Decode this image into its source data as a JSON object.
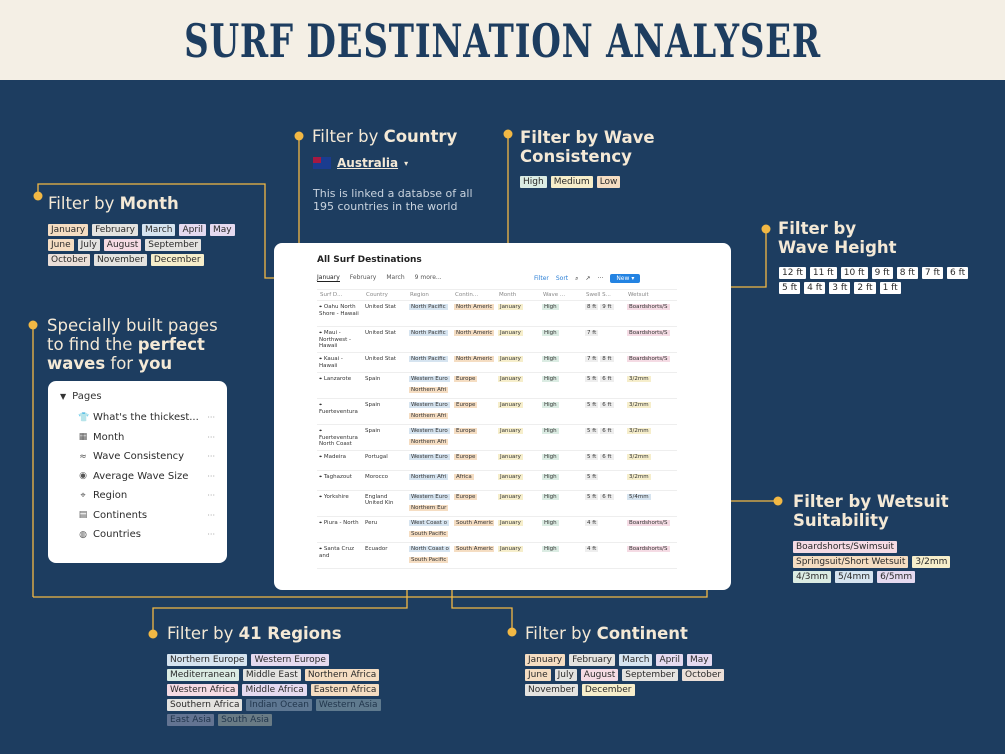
{
  "title": "SURF DESTINATION ANALYSER",
  "sections": {
    "country": {
      "heading_pre": "Filter by ",
      "heading_bold": "Country",
      "selected": "Australia",
      "note_line1": "This is linked a databse of all",
      "note_line2": "195 countries in the world"
    },
    "month": {
      "heading_pre": "Filter by ",
      "heading_bold": "Month",
      "chips": [
        {
          "label": "January",
          "color": "orange"
        },
        {
          "label": "February",
          "color": "gray"
        },
        {
          "label": "March",
          "color": "blue"
        },
        {
          "label": "April",
          "color": "purple"
        },
        {
          "label": "May",
          "color": "purple"
        },
        {
          "label": "June",
          "color": "orange"
        },
        {
          "label": "July",
          "color": "gray"
        },
        {
          "label": "August",
          "color": "pink"
        },
        {
          "label": "September",
          "color": "gray"
        },
        {
          "label": "October",
          "color": "brown"
        },
        {
          "label": "November",
          "color": "gray"
        },
        {
          "label": "December",
          "color": "yellow"
        }
      ]
    },
    "consistency": {
      "heading_line1": "Filter by Wave",
      "heading_line2": "Consistency",
      "chips": [
        {
          "label": "High",
          "color": "green"
        },
        {
          "label": "Medium",
          "color": "yellow"
        },
        {
          "label": "Low",
          "color": "orange"
        }
      ]
    },
    "wave_height": {
      "heading_line1": "Filter by",
      "heading_line2": "Wave Height",
      "chips": [
        "12 ft",
        "11 ft",
        "10 ft",
        "9 ft",
        "8 ft",
        "7 ft",
        "6 ft",
        "5 ft",
        "4 ft",
        "3 ft",
        "2 ft",
        "1 ft"
      ]
    },
    "pages_promo": {
      "line1": "Specially built pages",
      "line2_pre": "to find the ",
      "line2_bold": "perfect",
      "line3_bold1": "waves",
      "line3_mid": " for ",
      "line3_bold2": "you"
    },
    "wetsuit": {
      "heading_line1": "Filter by Wetsuit",
      "heading_line2": "Suitability",
      "chips": [
        {
          "label": "Boardshorts/Swimsuit",
          "color": "pink"
        },
        {
          "label": "Springsuit/Short Wetsuit",
          "color": "orange"
        },
        {
          "label": "3/2mm",
          "color": "yellow"
        },
        {
          "label": "4/3mm",
          "color": "green"
        },
        {
          "label": "5/4mm",
          "color": "blue"
        },
        {
          "label": "6/5mm",
          "color": "purple"
        }
      ]
    },
    "regions": {
      "heading_pre": "Filter by ",
      "heading_bold": "41 Regions",
      "chips": [
        {
          "label": "Northern Europe",
          "color": "blue"
        },
        {
          "label": "Western Europe",
          "color": "purple"
        },
        {
          "label": "Mediterranean",
          "color": "green"
        },
        {
          "label": "Middle East",
          "color": "gray"
        },
        {
          "label": "Northern Africa",
          "color": "orange"
        },
        {
          "label": "Western Africa",
          "color": "pink"
        },
        {
          "label": "Middle Africa",
          "color": "purple"
        },
        {
          "label": "Eastern Africa",
          "color": "orange"
        },
        {
          "label": "Southern Africa",
          "color": "gray"
        },
        {
          "label": "Indian Ocean",
          "color": "blue"
        },
        {
          "label": "Western Asia",
          "color": "green"
        },
        {
          "label": "East Asia",
          "color": "purple"
        },
        {
          "label": "South Asia",
          "color": "yellow"
        }
      ]
    },
    "continent": {
      "heading_pre": "Filter by ",
      "heading_bold": "Continent",
      "chips": [
        {
          "label": "January",
          "color": "orange"
        },
        {
          "label": "February",
          "color": "gray"
        },
        {
          "label": "March",
          "color": "blue"
        },
        {
          "label": "April",
          "color": "purple"
        },
        {
          "label": "May",
          "color": "purple"
        },
        {
          "label": "June",
          "color": "orange"
        },
        {
          "label": "July",
          "color": "gray"
        },
        {
          "label": "August",
          "color": "pink"
        },
        {
          "label": "September",
          "color": "gray"
        },
        {
          "label": "October",
          "color": "brown"
        },
        {
          "label": "November",
          "color": "gray"
        },
        {
          "label": "December",
          "color": "yellow"
        }
      ]
    }
  },
  "pages_panel": {
    "header": "Pages",
    "items": [
      {
        "label": "What's the thickest...",
        "icon": "shirt-icon"
      },
      {
        "label": "Month",
        "icon": "calendar-icon"
      },
      {
        "label": "Wave Consistency",
        "icon": "wave-icon"
      },
      {
        "label": "Average Wave Size",
        "icon": "eye-icon"
      },
      {
        "label": "Region",
        "icon": "location-pin-icon"
      },
      {
        "label": "Continents",
        "icon": "table-icon"
      },
      {
        "label": "Countries",
        "icon": "globe-icon"
      }
    ]
  },
  "database": {
    "title": "All Surf Destinations",
    "tabs": [
      "January",
      "February",
      "March",
      "9 more..."
    ],
    "actions": {
      "filter": "Filter",
      "sort": "Sort",
      "new": "New"
    },
    "columns": [
      "Surf D...",
      "Country",
      "Region",
      "Contin...",
      "Month",
      "Wave ...",
      "Swell S...",
      "Wetsuit"
    ],
    "rows": [
      {
        "name": "Oahu North Shore - Hawaii",
        "country": "United Stat",
        "regions": [
          "North Pacific"
        ],
        "continent": "North Americ",
        "month": "January",
        "wave": "High",
        "swell": [
          "8 ft",
          "9 ft"
        ],
        "wetsuit": "Boardshorts/S"
      },
      {
        "name": "Maui - Northwest - Hawaii",
        "country": "United Stat",
        "regions": [
          "North Pacific"
        ],
        "continent": "North Americ",
        "month": "January",
        "wave": "High",
        "swell": [
          "7 ft"
        ],
        "wetsuit": "Boardshorts/S"
      },
      {
        "name": "Kauai - Hawaii",
        "country": "United Stat",
        "regions": [
          "North Pacific"
        ],
        "continent": "North Americ",
        "month": "January",
        "wave": "High",
        "swell": [
          "7 ft",
          "8 ft"
        ],
        "wetsuit": "Boardshorts/S"
      },
      {
        "name": "Lanzarote",
        "country": "Spain",
        "regions": [
          "Western Euro",
          "Northern Afri"
        ],
        "continent": "Europe",
        "month": "January",
        "wave": "High",
        "swell": [
          "5 ft",
          "6 ft"
        ],
        "wetsuit": "3/2mm"
      },
      {
        "name": "Fuerteventura",
        "country": "Spain",
        "regions": [
          "Western Euro",
          "Northern Afri"
        ],
        "continent": "Europe",
        "month": "January",
        "wave": "High",
        "swell": [
          "5 ft",
          "6 ft"
        ],
        "wetsuit": "3/2mm"
      },
      {
        "name": "Fuerteventura North Coast",
        "country": "Spain",
        "regions": [
          "Western Euro",
          "Northern Afri"
        ],
        "continent": "Europe",
        "month": "January",
        "wave": "High",
        "swell": [
          "5 ft",
          "6 ft"
        ],
        "wetsuit": "3/2mm"
      },
      {
        "name": "Madeira",
        "country": "Portugal",
        "regions": [
          "Western Euro"
        ],
        "continent": "Europe",
        "month": "January",
        "wave": "High",
        "swell": [
          "5 ft",
          "6 ft"
        ],
        "wetsuit": "3/2mm"
      },
      {
        "name": "Taghazout",
        "country": "Morocco",
        "regions": [
          "Northern Afri"
        ],
        "continent": "Africa",
        "month": "January",
        "wave": "High",
        "swell": [
          "5 ft"
        ],
        "wetsuit": "3/2mm"
      },
      {
        "name": "Yorkshire",
        "country": "England",
        "country2": "United Kin",
        "regions": [
          "Western Euro",
          "Northern Eur"
        ],
        "continent": "Europe",
        "month": "January",
        "wave": "High",
        "swell": [
          "5 ft",
          "6 ft"
        ],
        "wetsuit": "5/4mm"
      },
      {
        "name": "Piura - North",
        "country": "Peru",
        "regions": [
          "West Coast o",
          "South Pacific"
        ],
        "continent": "South Americ",
        "month": "January",
        "wave": "High",
        "swell": [
          "4 ft"
        ],
        "wetsuit": "Boardshorts/S"
      },
      {
        "name": "Santa Cruz and",
        "country": "Ecuador",
        "regions": [
          "North Coast o",
          "South Pacific"
        ],
        "continent": "South Americ",
        "month": "January",
        "wave": "High",
        "swell": [
          "4 ft"
        ],
        "wetsuit": "Boardshorts/S"
      }
    ]
  },
  "colors": {
    "background": "#1d3d60",
    "title_band": "#f4efe5",
    "title_text": "#1d3d60",
    "accent_dot": "#f2b844",
    "text_light": "#f4e9d6"
  }
}
